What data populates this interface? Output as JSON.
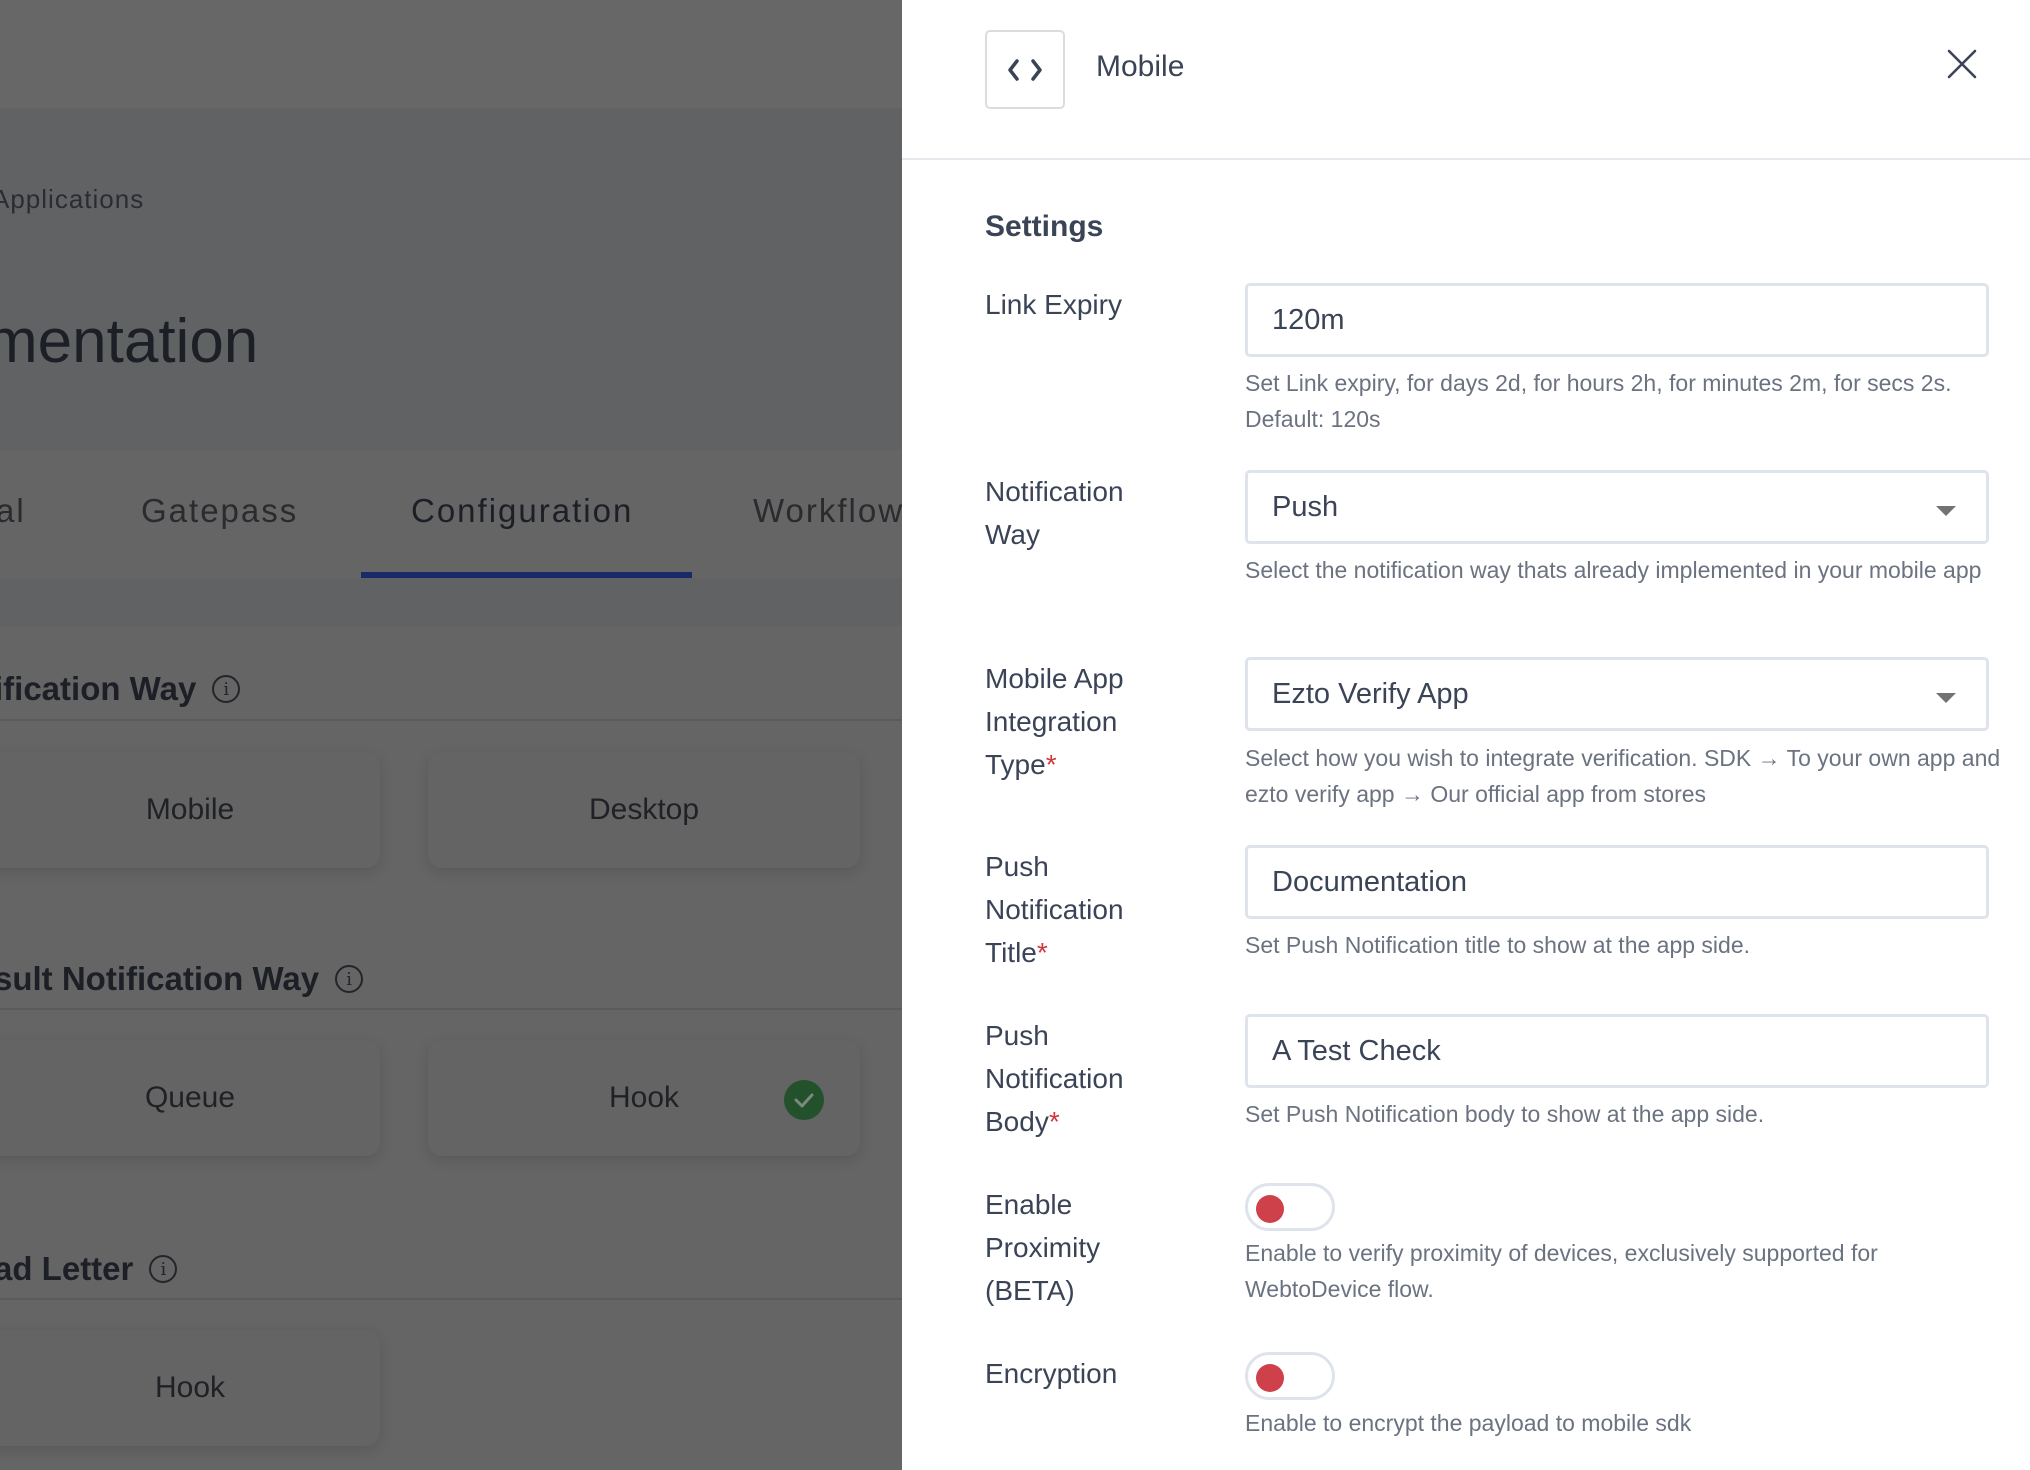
{
  "background": {
    "breadcrumb": "Applications",
    "page_title": "mentation",
    "tabs": [
      {
        "label": "al",
        "active": false
      },
      {
        "label": "Gatepass",
        "active": false
      },
      {
        "label": "Configuration",
        "active": true
      },
      {
        "label": "Workflow",
        "active": false
      }
    ],
    "sections": [
      {
        "title": "ification Way",
        "cards": [
          {
            "label": "Mobile",
            "selected": false
          },
          {
            "label": "Desktop",
            "selected": false
          }
        ]
      },
      {
        "title": "sult Notification Way",
        "cards": [
          {
            "label": "Queue",
            "selected": false
          },
          {
            "label": "Hook",
            "selected": true
          }
        ]
      },
      {
        "title": "ad Letter",
        "cards": [
          {
            "label": "Hook",
            "selected": false
          }
        ]
      }
    ]
  },
  "panel": {
    "icon": "code-brackets-icon",
    "title": "Mobile",
    "close_icon": "close-icon",
    "settings_heading": "Settings",
    "fields": {
      "link_expiry": {
        "label": "Link Expiry",
        "value": "120m",
        "help": "Set Link expiry, for days 2d, for hours 2h, for minutes 2m, for secs 2s. Default: 120s"
      },
      "notification_way": {
        "label_line1": "Notification",
        "label_line2": "Way",
        "value": "Push",
        "help": "Select the notification way thats already implemented in your mobile app"
      },
      "integration_type": {
        "label_line1": "Mobile App",
        "label_line2": "Integration",
        "label_line3": "Type",
        "required": "*",
        "value": "Ezto Verify App",
        "help": "Select how you wish to integrate verification. SDK → To your own app and ezto verify app → Our official app from stores"
      },
      "push_title": {
        "label_line1": "Push",
        "label_line2": "Notification",
        "label_line3": "Title",
        "required": "*",
        "value": "Documentation",
        "help": "Set Push Notification title to show at the app side."
      },
      "push_body": {
        "label_line1": "Push",
        "label_line2": "Notification",
        "label_line3": "Body",
        "required": "*",
        "value": "A Test Check",
        "help": "Set Push Notification body to show at the app side."
      },
      "proximity": {
        "label_line1": "Enable",
        "label_line2": "Proximity",
        "label_line3": "(BETA)",
        "enabled": false,
        "help": "Enable to verify proximity of devices, exclusively supported for WebtoDevice flow."
      },
      "encryption": {
        "label": "Encryption",
        "enabled": false,
        "help": "Enable to encrypt the payload to mobile sdk"
      }
    }
  },
  "colors": {
    "overlay": "#616264",
    "tab_active_underline": "#1a2a66",
    "toggle_off_knob": "#cf414a",
    "required_star": "#d1373f",
    "selected_check": "#22512b",
    "input_border": "#dfe3ec",
    "text_primary": "#3b4456",
    "text_help": "#6b7280"
  }
}
